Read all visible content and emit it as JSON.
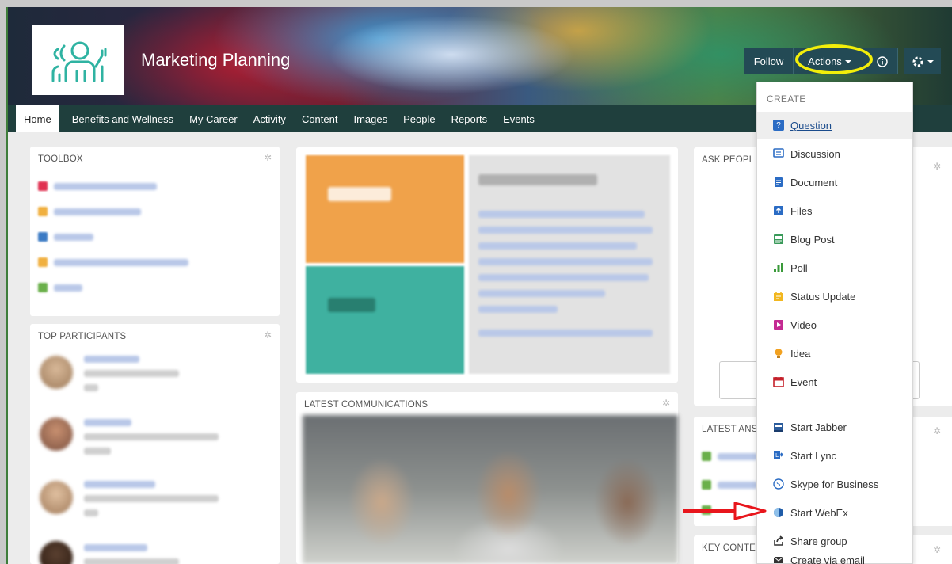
{
  "header": {
    "title": "Marketing Planning",
    "follow_label": "Follow",
    "actions_label": "Actions",
    "info_icon": "info-icon",
    "gear_icon": "gear-icon"
  },
  "nav": {
    "items": [
      "Home",
      "Benefits and Wellness",
      "My Career",
      "Activity",
      "Content",
      "Images",
      "People",
      "Reports",
      "Events"
    ],
    "active": "Home"
  },
  "cards": {
    "toolbox_title": "TOOLBOX",
    "top_participants_title": "TOP PARTICIPANTS",
    "latest_communications_title": "LATEST COMMUNICATIONS",
    "ask_people_title": "ASK PEOPL",
    "latest_answers_title": "LATEST ANS",
    "key_content_title": "KEY CONTE"
  },
  "actions_menu": {
    "header": "CREATE",
    "items": [
      {
        "label": "Question",
        "icon": "question-icon",
        "color": "#2b6cc4",
        "selected": true
      },
      {
        "label": "Discussion",
        "icon": "discussion-icon",
        "color": "#2b6cc4"
      },
      {
        "label": "Document",
        "icon": "document-icon",
        "color": "#2b6cc4"
      },
      {
        "label": "Files",
        "icon": "files-icon",
        "color": "#2b6cc4"
      },
      {
        "label": "Blog Post",
        "icon": "blog-post-icon",
        "color": "#3a9a5a"
      },
      {
        "label": "Poll",
        "icon": "poll-icon",
        "color": "#3a9a3a"
      },
      {
        "label": "Status Update",
        "icon": "status-update-icon",
        "color": "#f2b71f"
      },
      {
        "label": "Video",
        "icon": "video-icon",
        "color": "#c42a92"
      },
      {
        "label": "Idea",
        "icon": "idea-icon",
        "color": "#f2a11f"
      },
      {
        "label": "Event",
        "icon": "event-icon",
        "color": "#c4202a"
      },
      {
        "label": "Start Jabber",
        "icon": "jabber-icon",
        "color": "#2b5c9c"
      },
      {
        "label": "Start Lync",
        "icon": "lync-icon",
        "color": "#2b6cc4"
      },
      {
        "label": "Skype for Business",
        "icon": "skype-icon",
        "color": "#2b6cc4"
      },
      {
        "label": "Start WebEx",
        "icon": "webex-icon",
        "color": "#1f5ca8"
      },
      {
        "label": "Share group",
        "icon": "share-icon",
        "color": "#333333"
      },
      {
        "label": "Create via email",
        "icon": "email-icon",
        "color": "#333333"
      }
    ]
  },
  "colors": {
    "nav_bg": "#1f3f3d",
    "button_bg": "#234a55",
    "highlight": "#f2ee0a",
    "arrow": "#e8161c"
  }
}
